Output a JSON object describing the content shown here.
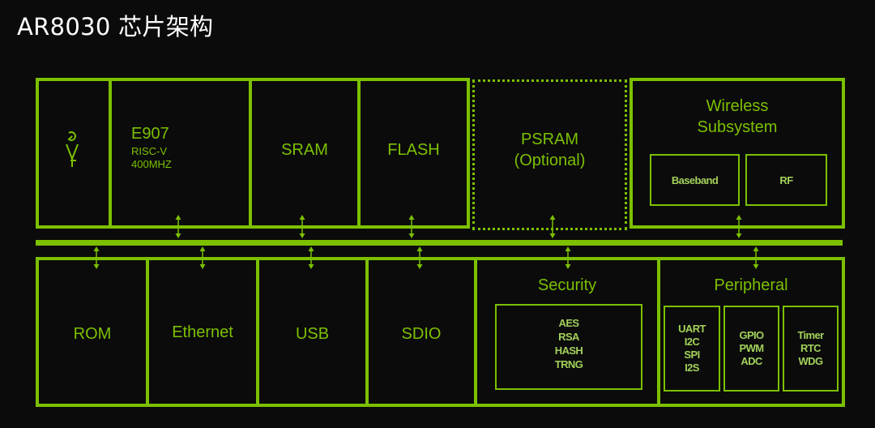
{
  "title": "AR8030 芯片架构",
  "colors": {
    "accent": "#7cc000",
    "sub_text": "#a3d15a",
    "background": "#0b0b0b",
    "title": "#ffffff"
  },
  "top_row": {
    "antenna_icon": "antenna-icon",
    "cpu": {
      "name": "E907",
      "arch": "RISC-V",
      "freq": "400MHZ"
    },
    "sram": "SRAM",
    "flash": "FLASH",
    "psram": {
      "line1": "PSRAM",
      "line2": "(Optional)"
    },
    "wireless": {
      "line1": "Wireless",
      "line2": "Subsystem",
      "baseband": "Baseband",
      "rf": "RF"
    }
  },
  "bus_label": "",
  "bottom_row": {
    "rom": "ROM",
    "ethernet": "Ethernet",
    "usb": "USB",
    "sdio": "SDIO",
    "security": {
      "title": "Security",
      "items": [
        "AES",
        "RSA",
        "HASH",
        "TRNG"
      ]
    },
    "peripheral": {
      "title": "Peripheral",
      "groups": [
        [
          "UART",
          "I2C",
          "SPI",
          "I2S"
        ],
        [
          "GPIO",
          "PWM",
          "ADC"
        ],
        [
          "Timer",
          "RTC",
          "WDG"
        ]
      ]
    }
  }
}
